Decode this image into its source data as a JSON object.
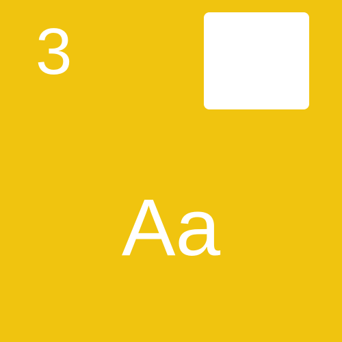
{
  "tile": {
    "number": "3",
    "sample_text": "Aa",
    "background_color": "#F0C40F",
    "foreground_color": "#FFFFFF",
    "swatch_color": "#FFFFFF"
  }
}
